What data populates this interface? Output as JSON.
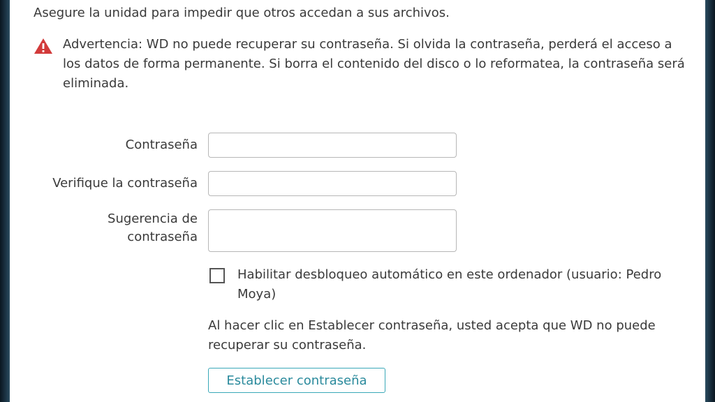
{
  "intro": "Asegure la unidad para impedir que otros accedan a sus archivos.",
  "warning": {
    "icon": "warning-triangle-icon",
    "text": "Advertencia: WD no puede recuperar su contraseña. Si olvida la contraseña, perderá el acceso a los datos de forma permanente. Si borra el contenido del disco o lo reformatea, la contraseña será eliminada."
  },
  "form": {
    "password_label": "Contraseña",
    "password_value": "",
    "verify_label": "Verifique la contraseña",
    "verify_value": "",
    "hint_label": "Sugerencia de contraseña",
    "hint_value": ""
  },
  "auto_unlock": {
    "label": "Habilitar desbloqueo automático en este ordenador (usuario: Pedro Moya)",
    "checked": false
  },
  "notice": "Al hacer clic en Establecer contraseña, usted acepta que WD no puede recuperar su contraseña.",
  "set_password_button": "Establecer contraseña",
  "colors": {
    "warning_icon": "#d23a3a",
    "button_border": "#3aa8b8",
    "button_text": "#2a8a9c",
    "text": "#3a3a3a"
  }
}
